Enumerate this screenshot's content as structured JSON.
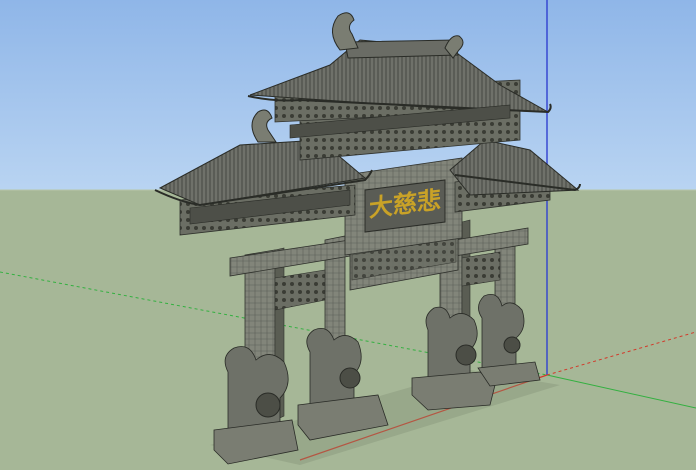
{
  "viewport": {
    "sky_color": "#a9c9ef",
    "sky_top_color": "#8fb6e8",
    "ground_color": "#a6b797",
    "horizon_color": "#b8c6a8"
  },
  "axes": {
    "red_axis": "#d23a2a",
    "green_axis": "#33b040",
    "blue_axis": "#3040d0"
  },
  "model": {
    "plaque": {
      "inscription": "大慈悲",
      "text_color": "#c9a227"
    },
    "stone_color": "#7d7f75",
    "stone_dark": "#3c3e37",
    "roof_color": "#6a6c65",
    "roof_dark": "#2f312c"
  }
}
